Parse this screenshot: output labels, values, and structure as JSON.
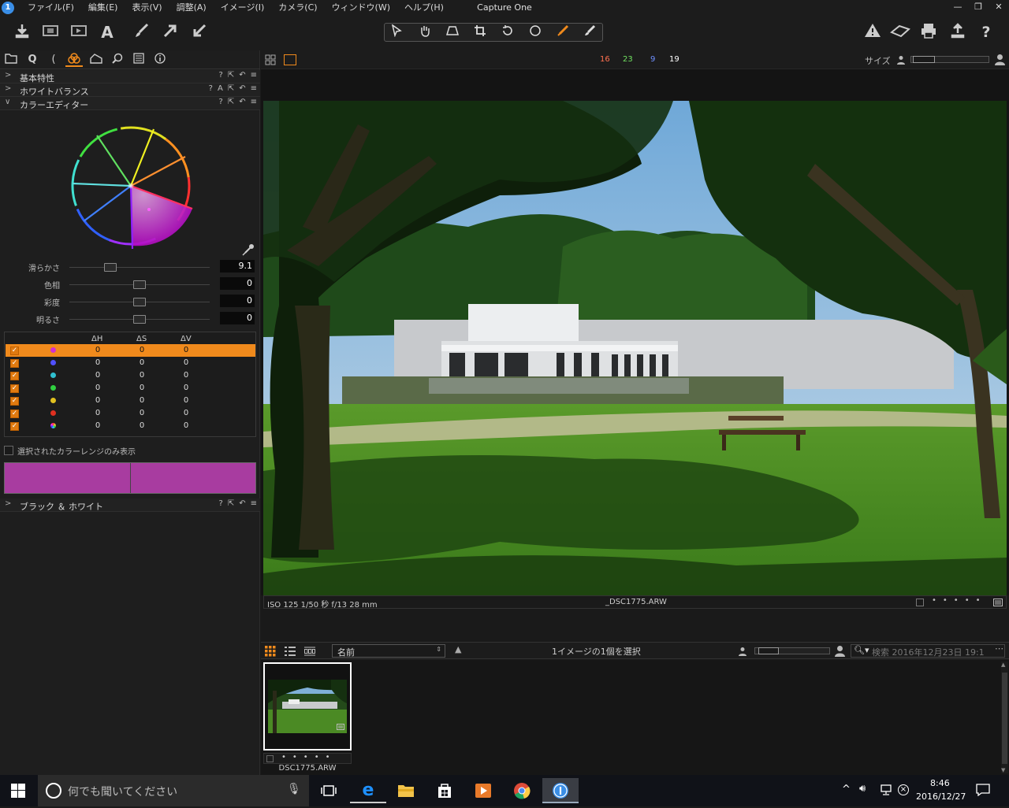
{
  "app": {
    "title": "Capture One",
    "icon_label": "1"
  },
  "menu": [
    "ファイル(F)",
    "編集(E)",
    "表示(V)",
    "調整(A)",
    "イメージ(I)",
    "カメラ(C)",
    "ウィンドウ(W)",
    "ヘルプ(H)"
  ],
  "window_controls": [
    "—",
    "❐",
    "✕"
  ],
  "toolbar": {
    "left_icons": [
      "import-icon",
      "capture-icon",
      "process-icon",
      "text-icon",
      "brush-icon",
      "arrow-up-right-icon",
      "arrow-down-left-icon"
    ],
    "cursor_tools": [
      "select-cursor-icon",
      "pan-icon",
      "keystone-icon",
      "crop-icon",
      "rotate-icon",
      "circle-icon",
      "color-picker-icon",
      "eraser-icon"
    ],
    "right_icons": [
      "warning-icon",
      "eraser-icon",
      "print-icon",
      "share-icon",
      "help-icon"
    ]
  },
  "tool_tabs": [
    "folder-icon",
    "quick-icon",
    "lens-icon",
    "color-icon",
    "exposure-icon",
    "details-icon",
    "metadata-icon",
    "info-icon"
  ],
  "sections": {
    "basic": "基本特性",
    "white_balance": "ホワイトバランス",
    "color_editor": "カラーエディター",
    "bw": "ブラック ＆ ホワイト"
  },
  "sliders": [
    {
      "label": "滑らかさ",
      "value": "9.1",
      "level": 0.29
    },
    {
      "label": "色相",
      "value": "0",
      "level": 0.5
    },
    {
      "label": "彩度",
      "value": "0",
      "level": 0.5
    },
    {
      "label": "明るさ",
      "value": "0",
      "level": 0.5
    }
  ],
  "color_table": {
    "headers": [
      "ΔH",
      "ΔS",
      "ΔV"
    ],
    "rows": [
      {
        "color": "#d030d0",
        "dh": "0",
        "ds": "0",
        "dv": "0",
        "selected": true
      },
      {
        "color": "#5050ff",
        "dh": "0",
        "ds": "0",
        "dv": "0",
        "selected": false
      },
      {
        "color": "#30c0d0",
        "dh": "0",
        "ds": "0",
        "dv": "0",
        "selected": false
      },
      {
        "color": "#30d040",
        "dh": "0",
        "ds": "0",
        "dv": "0",
        "selected": false
      },
      {
        "color": "#e0c020",
        "dh": "0",
        "ds": "0",
        "dv": "0",
        "selected": false
      },
      {
        "color": "#e03020",
        "dh": "0",
        "ds": "0",
        "dv": "0",
        "selected": false
      },
      {
        "color": "multi",
        "dh": "0",
        "ds": "0",
        "dv": "0",
        "selected": false
      }
    ]
  },
  "show_selected_only": "選択されたカラーレンジのみ表示",
  "swatch_color": "#a83ca0",
  "viewer": {
    "counts": [
      {
        "value": "16",
        "color": "#ff7050"
      },
      {
        "value": "23",
        "color": "#70e060"
      },
      {
        "value": "9",
        "color": "#7090ff"
      },
      {
        "value": "19",
        "color": "#ffffff"
      }
    ],
    "size_label": "サイズ",
    "info_left": "ISO 125  1/50 秒  f/13  28 mm",
    "info_file": "_DSC1775.ARW"
  },
  "browser": {
    "sort": "名前",
    "selection": "1イメージの1個を選択",
    "search_placeholder": "検索 2016年12月23日 19:1",
    "thumb_name": "DSC1775.ARW"
  },
  "taskbar": {
    "search": "何でも聞いてください",
    "time": "8:46",
    "date": "2016/12/27"
  }
}
